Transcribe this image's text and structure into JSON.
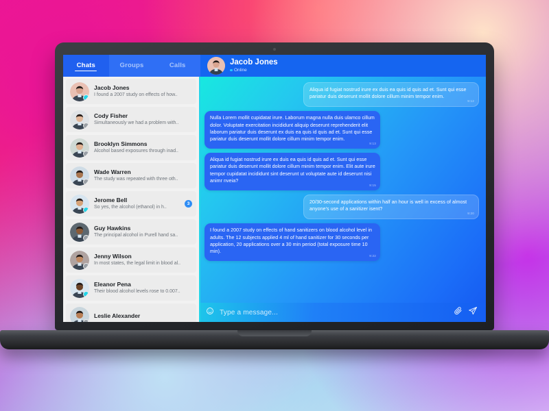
{
  "app": {
    "peer": {
      "name": "Jacob Jones",
      "status": "Online"
    }
  },
  "tabs": [
    {
      "id": "chats",
      "label": "Chats",
      "active": true
    },
    {
      "id": "groups",
      "label": "Groups",
      "active": false
    },
    {
      "id": "calls",
      "label": "Calls",
      "active": false
    }
  ],
  "chat_list": [
    {
      "name": "Jacob Jones",
      "preview": "I found a 2007 study on effects of how..",
      "online": true,
      "badge": "",
      "skin": "#d8a48f",
      "bg": "#e9c0b3"
    },
    {
      "name": "Cody Fisher",
      "preview": "Simultaneously we had a problem with..",
      "online": false,
      "badge": "",
      "skin": "#e2b79a",
      "bg": "#dfe3e6"
    },
    {
      "name": "Brooklyn Simmons",
      "preview": "Alcohol based exposures through inad..",
      "online": false,
      "badge": "",
      "skin": "#e0b293",
      "bg": "#cfd9d4"
    },
    {
      "name": "Wade Warren",
      "preview": "The study was repeated with three oth..",
      "online": false,
      "badge": "",
      "skin": "#a9764f",
      "bg": "#cfdce6"
    },
    {
      "name": "Jerome Bell",
      "preview": "So yes, the alcohol (ethanol) in h..",
      "online": true,
      "badge": "3",
      "skin": "#d6a379",
      "bg": "#d7e5f0"
    },
    {
      "name": "Guy Hawkins",
      "preview": "The principal alcohol in Purell hand sa..",
      "online": false,
      "badge": "",
      "skin": "#8a5a38",
      "bg": "#5d6870"
    },
    {
      "name": "Jenny Wilson",
      "preview": "In most states, the legal limit in blood al..",
      "online": false,
      "badge": "",
      "skin": "#c08a63",
      "bg": "#b0a3a0"
    },
    {
      "name": "Eleanor Pena",
      "preview": "Their blood alcohol levels rose to 0.007..",
      "online": true,
      "badge": "",
      "skin": "#6b4427",
      "bg": "#d9e6ef"
    },
    {
      "name": "Leslie Alexander",
      "preview": "",
      "online": false,
      "badge": "",
      "skin": "#b97f55",
      "bg": "#c9d6dd"
    }
  ],
  "messages": [
    {
      "side": "out",
      "text": "Aliqua id fugiat nostrud irure ex duis ea quis id quis ad et. Sunt qui esse pariatur duis deserunt mollit dolore cillum minim tempor enim.",
      "time": "9:12"
    },
    {
      "side": "in",
      "text": "Nulla Lorem mollit cupidatat irure. Laborum magna nulla duis ulamco cillum dolor. Voluptate exercitation incididunt aliquip deserunt reprehenderit elit laborum  pariatur duis deserunt ex duis ea quis id quis ad et. Sunt qui esse pariatur duis deserunt mollit dolore cillum minim tempor enim.",
      "time": "9:13"
    },
    {
      "side": "in",
      "text": "Aliqua id fugiat nostrud irure ex duis ea quis id quis ad et. Sunt qui esse pariatur duis deserunt mollit dolore cillum minim tempor enim. Elit aute irure tempor cupidatat incididunt sint deserunt ut voluptate aute id deserunt nisi animr nveia?",
      "time": "9:15"
    },
    {
      "side": "out",
      "text": "20/30-second applications within half an hour is well in excess of almost anyone's use of a sanitizer isent?",
      "time": "9:20"
    },
    {
      "side": "in",
      "text": "I found a 2007 study on effects of hand sanitizers on blood alcohol level in adults. The 12 subjects applied 4 ml of hand sanitizer for 30 seconds per application, 20 applications over a 30 min period (total exposure time 10 min).",
      "time": "9:22"
    }
  ],
  "composer": {
    "placeholder": "Type a message...",
    "value": ""
  },
  "colors": {
    "brand_blue": "#1565f0",
    "accent_cyan": "#23d5e8",
    "bubble_in": "#2a65f3",
    "badge": "#2f8df5"
  }
}
